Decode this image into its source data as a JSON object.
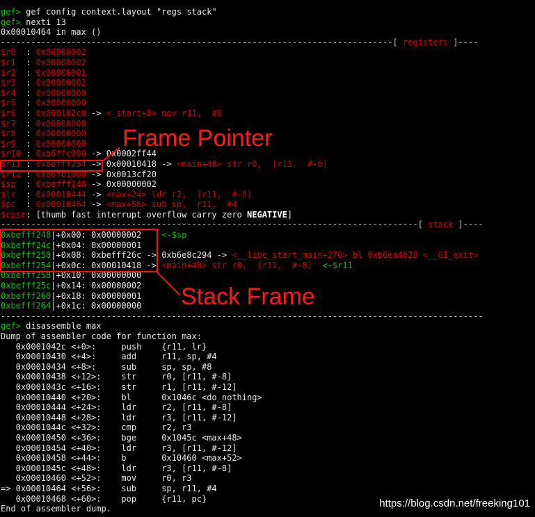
{
  "session": {
    "cmd1_prompt": "gef>",
    "cmd1": " gef config context.layout \"regs stack\"",
    "cmd2_prompt": "gef>",
    "cmd2": " nexti 13",
    "location": "0x00010464 in max ()"
  },
  "sep_registers": {
    "dashes": "------------------------------------------------------------------------------[ ",
    "label": "registers",
    "tail": " ]----"
  },
  "registers": [
    {
      "name": "$r0  ",
      "val": "0x00000002",
      "rest": ""
    },
    {
      "name": "$r1  ",
      "val": "0x00000002",
      "rest": ""
    },
    {
      "name": "$r2  ",
      "val": "0x00000001",
      "rest": ""
    },
    {
      "name": "$r3  ",
      "val": "0x00000002",
      "rest": ""
    },
    {
      "name": "$r4  ",
      "val": "0x00000000",
      "rest": ""
    },
    {
      "name": "$r5  ",
      "val": "0x00000000",
      "rest": ""
    },
    {
      "name": "$r6  ",
      "val": "0x000102c0",
      "rest": " -> ",
      "sym": "<_start+0> mov r11,  #0"
    },
    {
      "name": "$r7  ",
      "val": "0x00000000",
      "rest": ""
    },
    {
      "name": "$r8  ",
      "val": "0x00000000",
      "rest": ""
    },
    {
      "name": "$r9  ",
      "val": "0x00000000",
      "rest": ""
    },
    {
      "name": "$r10 ",
      "val": "0xb6ffc000",
      "rest": " -> 0x0002ff44"
    },
    {
      "name": "$r11 ",
      "val": "0xbefff254",
      "rest": " -> 0x00010418 -> ",
      "sym": "<main+48> str r0,  [r11,  #-8]"
    },
    {
      "name": "$r12 ",
      "val": "0xb6fb1000",
      "rest": " -> 0x0013cf20"
    },
    {
      "name": "$sp  ",
      "val": "0xbefff248",
      "rest": " -> 0x00000002"
    },
    {
      "name": "$lr  ",
      "val": "0x00010444",
      "rest": " -> ",
      "sym": "<max+24> ldr r2,  [r11,  #-8]"
    },
    {
      "name": "$pc  ",
      "val": "0x00010464",
      "rest": " -> ",
      "sym": "<max+56> sub sp,  r11,  #4"
    }
  ],
  "cpsr": {
    "name": "$cpsr",
    "text": ": [thumb fast interrupt overflow carry zero ",
    "flag": "NEGATIVE",
    "end": "]"
  },
  "sep_stack": {
    "dashes": "-----------------------------------------------------------------------------------[ ",
    "label": "stack",
    "tail": " ]----"
  },
  "stack": [
    {
      "addr": "0xbefff248",
      "off": "|+0x00: ",
      "val": "0x00000002",
      "rest": "    ",
      "note": "<-$sp"
    },
    {
      "addr": "0xbefff24c",
      "off": "|+0x04: ",
      "val": "0x00000001",
      "rest": ""
    },
    {
      "addr": "0xbefff250",
      "off": "|+0x08: ",
      "val": "0xbefff26c",
      "rest": " -> 0xb6e8c294 -> ",
      "sym": "<__libc_start_main+276> bl 0xb6ea4b28 <__GI_exit>"
    },
    {
      "addr": "0xbefff254",
      "off": "|+0x0c: ",
      "val": "0x00010418",
      "rest": " -> ",
      "sym": "<main+48> str r0,  [r11,  #-8]",
      "note": "  <-$r11"
    },
    {
      "addr": "0xbefff258",
      "off": "|+0x10: ",
      "val": "0x00000000",
      "rest": ""
    },
    {
      "addr": "0xbefff25c",
      "off": "|+0x14: ",
      "val": "0x00000002",
      "rest": ""
    },
    {
      "addr": "0xbefff260",
      "off": "|+0x18: ",
      "val": "0x00000001",
      "rest": ""
    },
    {
      "addr": "0xbefff264",
      "off": "|+0x1c: ",
      "val": "0x00000000",
      "rest": ""
    }
  ],
  "sep_end": "------------------------------------------------------------------------------------------------",
  "disasm": {
    "prompt": "gef>",
    "cmd": " disassemble max",
    "header": "Dump of assembler code for function max:",
    "lines": [
      "   0x0001042c <+0>:     push    {r11, lr}",
      "   0x00010430 <+4>:     add     r11, sp, #4",
      "   0x00010434 <+8>:     sub     sp, sp, #8",
      "   0x00010438 <+12>:    str     r0, [r11, #-8]",
      "   0x0001043c <+16>:    str     r1, [r11, #-12]",
      "   0x00010440 <+20>:    bl      0x1046c <do_nothing>",
      "   0x00010444 <+24>:    ldr     r2, [r11, #-8]",
      "   0x00010448 <+28>:    ldr     r3, [r11, #-12]",
      "   0x0001044c <+32>:    cmp     r2, r3",
      "   0x00010450 <+36>:    bge     0x1045c <max+48>",
      "   0x00010454 <+40>:    ldr     r3, [r11, #-12]",
      "   0x00010458 <+44>:    b       0x10460 <max+52>",
      "   0x0001045c <+48>:    ldr     r3, [r11, #-8]",
      "   0x00010460 <+52>:    mov     r0, r3",
      "=> 0x00010464 <+56>:    sub     sp, r11, #4",
      "   0x00010468 <+60>:    pop     {r11, pc}"
    ],
    "footer": "End of assembler dump."
  },
  "annotations": {
    "frame_pointer": "Frame Pointer",
    "stack_frame": "Stack Frame",
    "color": "#ff1010"
  },
  "watermark": "https://blog.csdn.net/freeking101"
}
